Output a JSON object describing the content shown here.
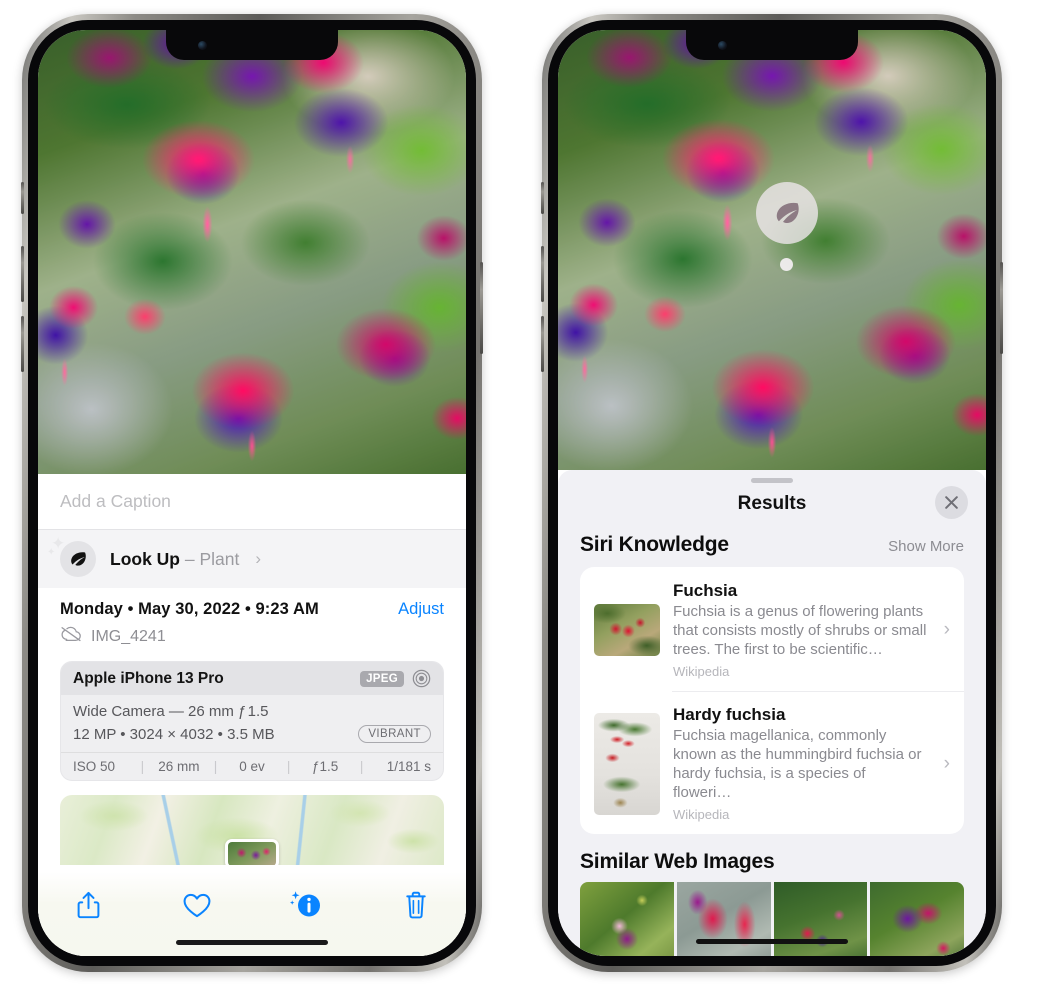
{
  "left_phone": {
    "photo": {
      "alt": "fuchsia-flowers-photo"
    },
    "caption": {
      "placeholder": "Add a Caption",
      "value": ""
    },
    "look_up": {
      "icon": "leaf-icon",
      "label": "Look Up",
      "dash": " – ",
      "subject": "Plant",
      "chevron": "›"
    },
    "meta": {
      "date": "Monday • May 30, 2022 • 9:23 AM",
      "adjust_label": "Adjust",
      "cloud_icon": "icloud-slash-icon",
      "filename": "IMG_4241"
    },
    "exif": {
      "model": "Apple iPhone 13 Pro",
      "format_badge": "JPEG",
      "ring_icon": "raw-circle-icon",
      "lens": "Wide Camera — 26 mm ƒ 1.5",
      "dimensions": "12 MP • 3024 × 4032 • 3.5 MB",
      "style_badge": "VIBRANT",
      "stats": [
        "ISO 50",
        "26 mm",
        "0 ev",
        "ƒ1.5",
        "1/181 s"
      ]
    },
    "map": {
      "name": "location-map",
      "pin": "photo-thumbnail-pin"
    },
    "toolbar": [
      {
        "name": "share-button",
        "icon": "share-icon"
      },
      {
        "name": "favorite-button",
        "icon": "heart-icon"
      },
      {
        "name": "info-button",
        "icon": "info-sparkle-icon"
      },
      {
        "name": "delete-button",
        "icon": "trash-icon"
      }
    ]
  },
  "right_phone": {
    "photo": {
      "alt": "fuchsia-flowers-photo"
    },
    "badge": {
      "icon": "leaf-icon",
      "name": "visual-lookup-badge"
    },
    "sheet": {
      "grabber": "drag-handle",
      "title": "Results",
      "close_icon": "close-icon"
    },
    "siri_knowledge": {
      "title": "Siri Knowledge",
      "show_more": "Show More",
      "items": [
        {
          "title": "Fuchsia",
          "description": "Fuchsia is a genus of flowering plants that consists mostly of shrubs or small trees. The first to be scientific…",
          "source": "Wikipedia",
          "thumb": "fuchsia-red-flowers-thumb",
          "chevron": "›"
        },
        {
          "title": "Hardy fuchsia",
          "description": "Fuchsia magellanica, commonly known as the hummingbird fuchsia or hardy fuchsia, is a species of floweri…",
          "source": "Wikipedia",
          "thumb": "hardy-fuchsia-branch-thumb",
          "chevron": "›"
        }
      ]
    },
    "similar_web_images": {
      "title": "Similar Web Images",
      "items": [
        {
          "name": "similar-image-1"
        },
        {
          "name": "similar-image-2"
        },
        {
          "name": "similar-image-3"
        },
        {
          "name": "similar-image-4"
        }
      ]
    }
  },
  "colors": {
    "accent_blue": "#0a84ff",
    "sheet_bg": "#f1f1f5",
    "card_bg": "#ffffff",
    "secondary_text": "#8a8a90"
  }
}
